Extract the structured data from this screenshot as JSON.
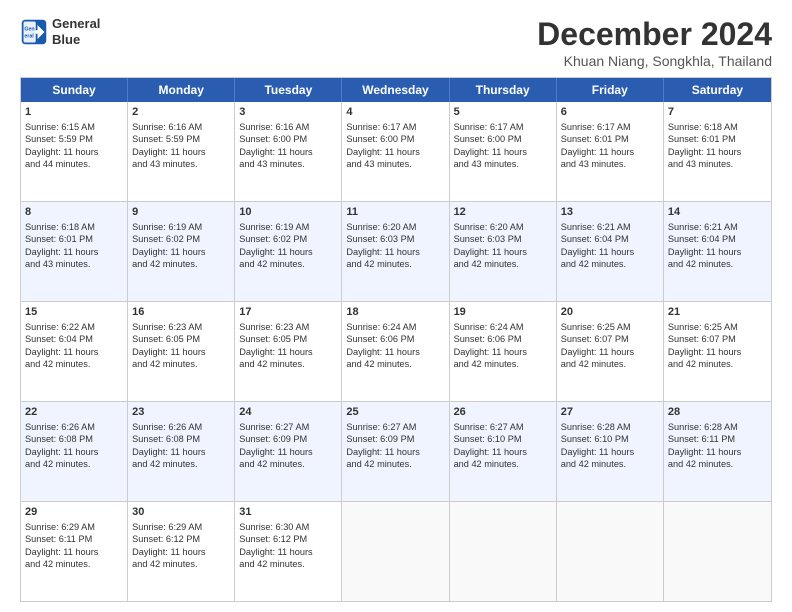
{
  "logo": {
    "line1": "General",
    "line2": "Blue"
  },
  "title": "December 2024",
  "subtitle": "Khuan Niang, Songkhla, Thailand",
  "weekdays": [
    "Sunday",
    "Monday",
    "Tuesday",
    "Wednesday",
    "Thursday",
    "Friday",
    "Saturday"
  ],
  "rows": [
    [
      {
        "day": "1",
        "lines": [
          "Sunrise: 6:15 AM",
          "Sunset: 5:59 PM",
          "Daylight: 11 hours",
          "and 44 minutes."
        ]
      },
      {
        "day": "2",
        "lines": [
          "Sunrise: 6:16 AM",
          "Sunset: 5:59 PM",
          "Daylight: 11 hours",
          "and 43 minutes."
        ]
      },
      {
        "day": "3",
        "lines": [
          "Sunrise: 6:16 AM",
          "Sunset: 6:00 PM",
          "Daylight: 11 hours",
          "and 43 minutes."
        ]
      },
      {
        "day": "4",
        "lines": [
          "Sunrise: 6:17 AM",
          "Sunset: 6:00 PM",
          "Daylight: 11 hours",
          "and 43 minutes."
        ]
      },
      {
        "day": "5",
        "lines": [
          "Sunrise: 6:17 AM",
          "Sunset: 6:00 PM",
          "Daylight: 11 hours",
          "and 43 minutes."
        ]
      },
      {
        "day": "6",
        "lines": [
          "Sunrise: 6:17 AM",
          "Sunset: 6:01 PM",
          "Daylight: 11 hours",
          "and 43 minutes."
        ]
      },
      {
        "day": "7",
        "lines": [
          "Sunrise: 6:18 AM",
          "Sunset: 6:01 PM",
          "Daylight: 11 hours",
          "and 43 minutes."
        ]
      }
    ],
    [
      {
        "day": "8",
        "lines": [
          "Sunrise: 6:18 AM",
          "Sunset: 6:01 PM",
          "Daylight: 11 hours",
          "and 43 minutes."
        ]
      },
      {
        "day": "9",
        "lines": [
          "Sunrise: 6:19 AM",
          "Sunset: 6:02 PM",
          "Daylight: 11 hours",
          "and 42 minutes."
        ]
      },
      {
        "day": "10",
        "lines": [
          "Sunrise: 6:19 AM",
          "Sunset: 6:02 PM",
          "Daylight: 11 hours",
          "and 42 minutes."
        ]
      },
      {
        "day": "11",
        "lines": [
          "Sunrise: 6:20 AM",
          "Sunset: 6:03 PM",
          "Daylight: 11 hours",
          "and 42 minutes."
        ]
      },
      {
        "day": "12",
        "lines": [
          "Sunrise: 6:20 AM",
          "Sunset: 6:03 PM",
          "Daylight: 11 hours",
          "and 42 minutes."
        ]
      },
      {
        "day": "13",
        "lines": [
          "Sunrise: 6:21 AM",
          "Sunset: 6:04 PM",
          "Daylight: 11 hours",
          "and 42 minutes."
        ]
      },
      {
        "day": "14",
        "lines": [
          "Sunrise: 6:21 AM",
          "Sunset: 6:04 PM",
          "Daylight: 11 hours",
          "and 42 minutes."
        ]
      }
    ],
    [
      {
        "day": "15",
        "lines": [
          "Sunrise: 6:22 AM",
          "Sunset: 6:04 PM",
          "Daylight: 11 hours",
          "and 42 minutes."
        ]
      },
      {
        "day": "16",
        "lines": [
          "Sunrise: 6:23 AM",
          "Sunset: 6:05 PM",
          "Daylight: 11 hours",
          "and 42 minutes."
        ]
      },
      {
        "day": "17",
        "lines": [
          "Sunrise: 6:23 AM",
          "Sunset: 6:05 PM",
          "Daylight: 11 hours",
          "and 42 minutes."
        ]
      },
      {
        "day": "18",
        "lines": [
          "Sunrise: 6:24 AM",
          "Sunset: 6:06 PM",
          "Daylight: 11 hours",
          "and 42 minutes."
        ]
      },
      {
        "day": "19",
        "lines": [
          "Sunrise: 6:24 AM",
          "Sunset: 6:06 PM",
          "Daylight: 11 hours",
          "and 42 minutes."
        ]
      },
      {
        "day": "20",
        "lines": [
          "Sunrise: 6:25 AM",
          "Sunset: 6:07 PM",
          "Daylight: 11 hours",
          "and 42 minutes."
        ]
      },
      {
        "day": "21",
        "lines": [
          "Sunrise: 6:25 AM",
          "Sunset: 6:07 PM",
          "Daylight: 11 hours",
          "and 42 minutes."
        ]
      }
    ],
    [
      {
        "day": "22",
        "lines": [
          "Sunrise: 6:26 AM",
          "Sunset: 6:08 PM",
          "Daylight: 11 hours",
          "and 42 minutes."
        ]
      },
      {
        "day": "23",
        "lines": [
          "Sunrise: 6:26 AM",
          "Sunset: 6:08 PM",
          "Daylight: 11 hours",
          "and 42 minutes."
        ]
      },
      {
        "day": "24",
        "lines": [
          "Sunrise: 6:27 AM",
          "Sunset: 6:09 PM",
          "Daylight: 11 hours",
          "and 42 minutes."
        ]
      },
      {
        "day": "25",
        "lines": [
          "Sunrise: 6:27 AM",
          "Sunset: 6:09 PM",
          "Daylight: 11 hours",
          "and 42 minutes."
        ]
      },
      {
        "day": "26",
        "lines": [
          "Sunrise: 6:27 AM",
          "Sunset: 6:10 PM",
          "Daylight: 11 hours",
          "and 42 minutes."
        ]
      },
      {
        "day": "27",
        "lines": [
          "Sunrise: 6:28 AM",
          "Sunset: 6:10 PM",
          "Daylight: 11 hours",
          "and 42 minutes."
        ]
      },
      {
        "day": "28",
        "lines": [
          "Sunrise: 6:28 AM",
          "Sunset: 6:11 PM",
          "Daylight: 11 hours",
          "and 42 minutes."
        ]
      }
    ],
    [
      {
        "day": "29",
        "lines": [
          "Sunrise: 6:29 AM",
          "Sunset: 6:11 PM",
          "Daylight: 11 hours",
          "and 42 minutes."
        ]
      },
      {
        "day": "30",
        "lines": [
          "Sunrise: 6:29 AM",
          "Sunset: 6:12 PM",
          "Daylight: 11 hours",
          "and 42 minutes."
        ]
      },
      {
        "day": "31",
        "lines": [
          "Sunrise: 6:30 AM",
          "Sunset: 6:12 PM",
          "Daylight: 11 hours",
          "and 42 minutes."
        ]
      },
      {
        "day": "",
        "lines": []
      },
      {
        "day": "",
        "lines": []
      },
      {
        "day": "",
        "lines": []
      },
      {
        "day": "",
        "lines": []
      }
    ]
  ]
}
